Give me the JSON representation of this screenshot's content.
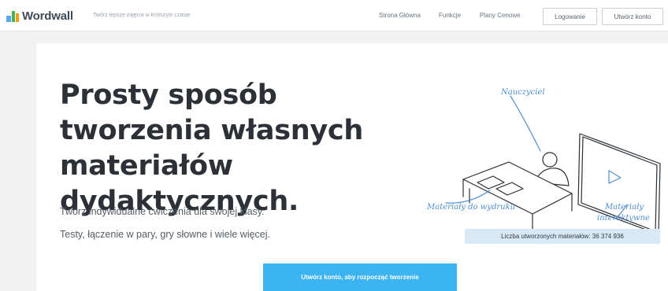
{
  "header": {
    "logo_text": "Wordwall",
    "tagline": "Twórz lepsze zajęcia w krótszym czasie",
    "nav": [
      "Strona Główna",
      "Funkcje",
      "Plany Cenowe"
    ],
    "login": "Logowanie",
    "signup": "Utwórz konto"
  },
  "hero": {
    "title": "Prosty sposób tworzenia własnych materiałów dydaktycznych.",
    "line1": "Twórz indywidualne ćwiczenia dla swojej klasy.",
    "line2": "Testy, łączenie w pary, gry słowne i wiele więcej.",
    "cta": "Utwórz konto, aby rozpocząć tworzenie"
  },
  "illustration": {
    "teacher_label": "Nauczyciel",
    "printable_label": "Materiały do wydruku",
    "interactive_label_1": "Materiały",
    "interactive_label_2": "interaktywne"
  },
  "counter": {
    "label": "Liczba utworzonych materiałów:",
    "value": "36 374 936"
  },
  "colors": {
    "accent": "#3cb4f2",
    "sketch": "#4f8fcf",
    "counter_bg": "#d9e8f5"
  }
}
